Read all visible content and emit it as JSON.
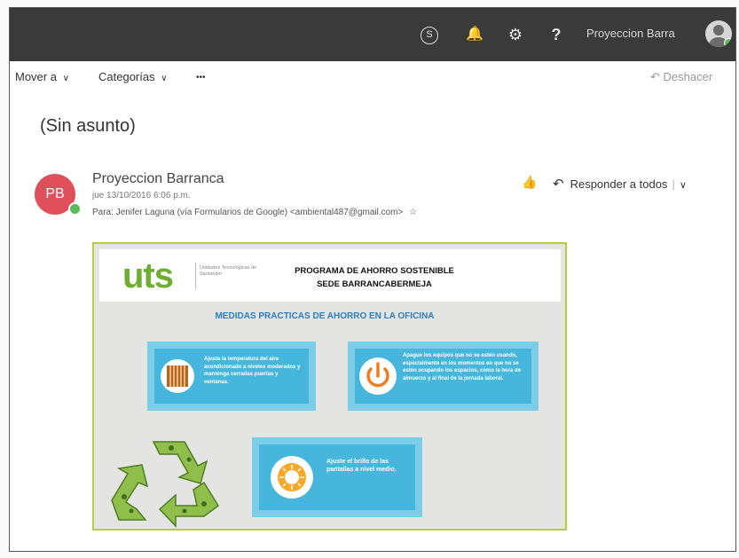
{
  "topbar": {
    "skype_icon": "skype-icon",
    "skype_glyph": "S",
    "bell_glyph": "🔔",
    "gear_glyph": "⚙",
    "help_glyph": "?",
    "user_name": "Proyeccion Barra"
  },
  "commands": {
    "move_to": "Mover a",
    "categories": "Categorías",
    "more": "•••",
    "dropdown_glyph": "∨",
    "undo": "Deshacer",
    "undo_glyph": "↶"
  },
  "message": {
    "subject": "(Sin asunto)",
    "avatar_initials": "PB",
    "sender": "Proyeccion Barranca",
    "date": "jue 13/10/2016 6:06 p.m.",
    "to_label": "Para:",
    "to_value": "Jenifer Laguna (vía Formularios de Google) <ambiental487@gmail.com>",
    "star_glyph": "☆",
    "like_glyph": "👍",
    "reply_all_glyph": "↶",
    "reply_all": "Responder a todos",
    "reply_dropdown_glyph": "∨"
  },
  "poster": {
    "logo": "uts",
    "logo_sub": "Unidades Tecnológicas de Santander",
    "title_line1": "PROGRAMA DE AHORRO SOSTENIBLE",
    "title_line2": "SEDE BARRANCABERMEJA",
    "subtitle": "MEDIDAS PRACTICAS DE AHORRO EN LA OFICINA",
    "card1": "Ajuste la temperatura del aire acondicionado a niveles moderados y mantenga cerradas puertas y ventanas.",
    "card2": "Apague los equipos que no se estén usando, especialmente en los momentos en que no se estén ocupando los espacios, como la hora de almuerzo y al final de la jornada laboral.",
    "card3": "Ajuste el brillo de las pantallas a nivel medio.",
    "colors": {
      "green": "#6fae32",
      "blue_title": "#2d7ec1",
      "card_light": "#7ccde8",
      "card_dark": "#47b6dc",
      "orange": "#f07c1e",
      "border": "#b9cc39"
    }
  }
}
